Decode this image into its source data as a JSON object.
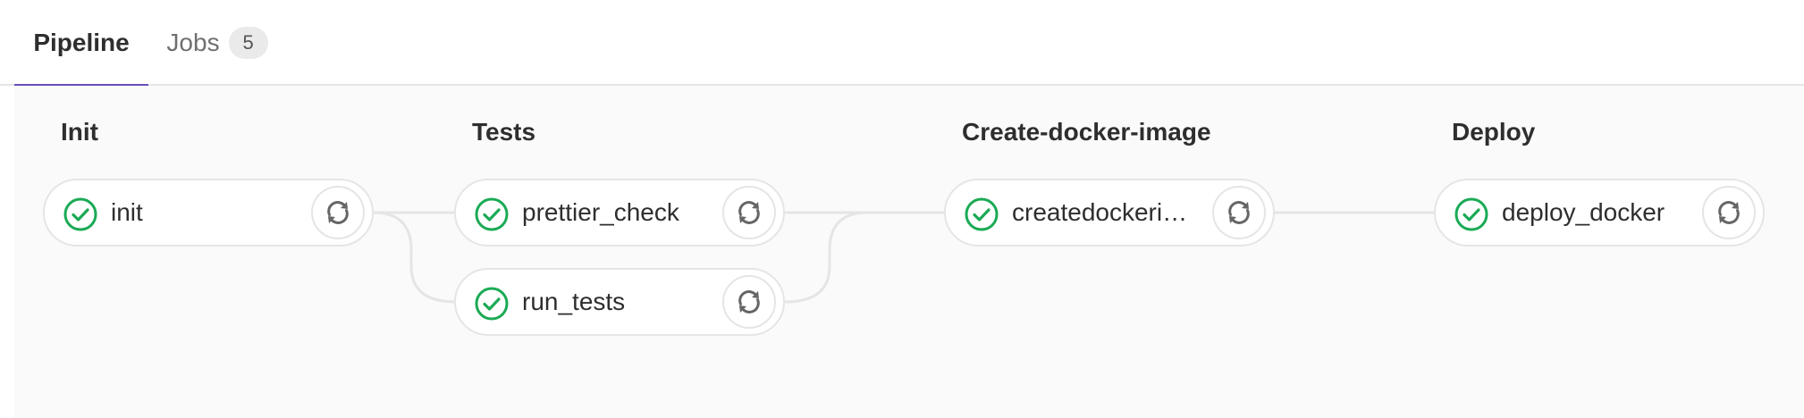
{
  "tabs": {
    "pipeline": "Pipeline",
    "jobs": "Jobs",
    "jobs_count": "5"
  },
  "stages": [
    {
      "title": "Init",
      "jobs": [
        {
          "name": "init",
          "status": "success"
        }
      ]
    },
    {
      "title": "Tests",
      "jobs": [
        {
          "name": "prettier_check",
          "status": "success"
        },
        {
          "name": "run_tests",
          "status": "success"
        }
      ]
    },
    {
      "title": "Create-docker-image",
      "jobs": [
        {
          "name": "createdockeri…",
          "status": "success"
        }
      ]
    },
    {
      "title": "Deploy",
      "jobs": [
        {
          "name": "deploy_docker",
          "status": "success"
        }
      ]
    }
  ],
  "colors": {
    "success": "#1aaa55",
    "active_tab": "#6b4fbb",
    "retry_icon": "#666666"
  },
  "icons": {
    "status": "status-success-icon",
    "retry": "retry-icon"
  }
}
